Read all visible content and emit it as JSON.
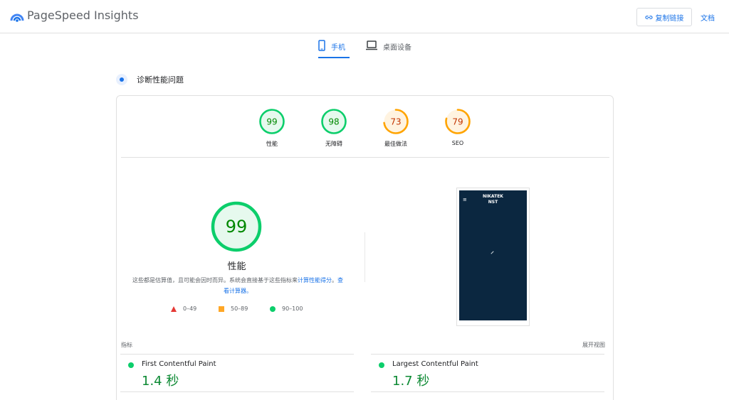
{
  "header": {
    "brand": "PageSpeed Insights",
    "copy_link_label": "复制链接",
    "docs_label": "文档"
  },
  "tabs": [
    {
      "label": "手机",
      "icon": "smartphone-icon",
      "active": true
    },
    {
      "label": "桌面设备",
      "icon": "laptop-icon",
      "active": false
    }
  ],
  "diagnose": {
    "title": "诊断性能问题"
  },
  "scores": [
    {
      "value": "99",
      "label": "性能",
      "score": 0.99,
      "color": "#0cce6b",
      "text_color": "#008800",
      "bg": "#e6f9ee"
    },
    {
      "value": "98",
      "label": "无障碍",
      "score": 0.98,
      "color": "#0cce6b",
      "text_color": "#008800",
      "bg": "#e6f9ee"
    },
    {
      "value": "73",
      "label": "最佳做法",
      "score": 0.73,
      "color": "#ffa400",
      "text_color": "#c33300",
      "bg": "#fff3e0"
    },
    {
      "value": "79",
      "label": "SEO",
      "score": 0.79,
      "color": "#ffa400",
      "text_color": "#c33300",
      "bg": "#fff3e0"
    }
  ],
  "performance": {
    "score": "99",
    "title": "性能",
    "desc_text": "这些都是估算值，且可能会因时而异。系统会直接基于这些指标来",
    "desc_link1": "计算性能得分",
    "desc_sep": "。",
    "desc_link2": "查看计算器。"
  },
  "legend": [
    {
      "range": "0–49",
      "shape": "triangle",
      "color": "#e53935"
    },
    {
      "range": "50–89",
      "shape": "square",
      "color": "#ffa726"
    },
    {
      "range": "90–100",
      "shape": "circle",
      "color": "#0cce6b"
    }
  ],
  "screenshot": {
    "menu_glyph": "≡",
    "brand_line1": "NIKATEK",
    "brand_line2": "NST"
  },
  "metrics_section": {
    "label": "指标",
    "expand_label": "展开视图"
  },
  "metrics": [
    {
      "name": "First Contentful Paint",
      "value": "1.4 秒",
      "status": "good"
    },
    {
      "name": "Largest Contentful Paint",
      "value": "1.7 秒",
      "status": "good"
    }
  ]
}
